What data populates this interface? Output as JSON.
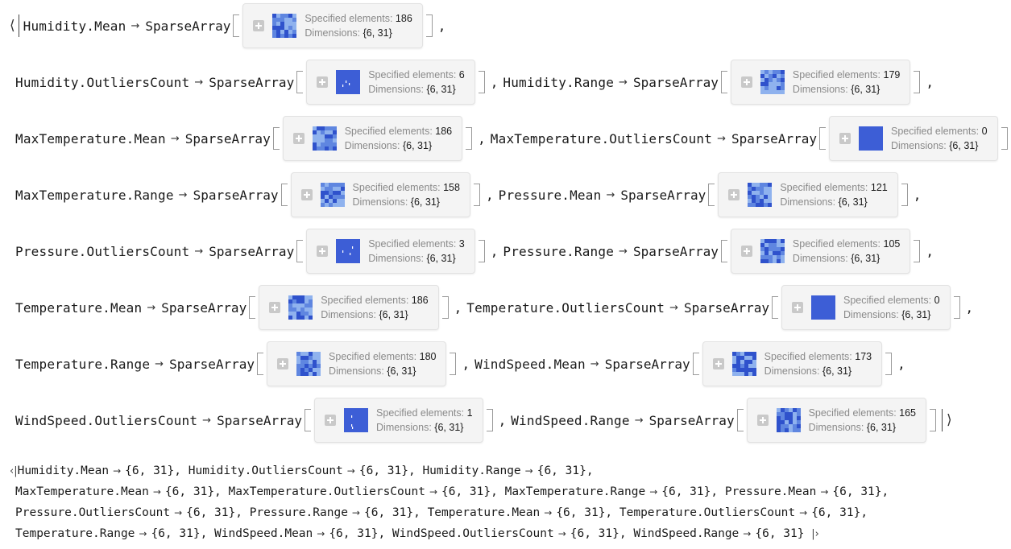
{
  "colors": {
    "blue": "#3d5ed6",
    "light_blue": "#7da3e8",
    "box_bg": "#f4f4f4",
    "label_gray": "#8a8a8a"
  },
  "labels": {
    "sparse_array": "SparseArray",
    "specified_elements": "Specified elements:",
    "dimensions": "Dimensions:",
    "arrow": "→",
    "open_assoc": "⟨",
    "close_assoc": "⟩",
    "comma": ","
  },
  "entries": [
    {
      "key": "Humidity.Mean",
      "specified": "186",
      "dims": "{6, 31}",
      "thumb": "dense"
    },
    {
      "key": "Humidity.OutliersCount",
      "specified": "6",
      "dims": "{6, 31}",
      "thumb": "sparse"
    },
    {
      "key": "Humidity.Range",
      "specified": "179",
      "dims": "{6, 31}",
      "thumb": "dense"
    },
    {
      "key": "MaxTemperature.Mean",
      "specified": "186",
      "dims": "{6, 31}",
      "thumb": "dense"
    },
    {
      "key": "MaxTemperature.OutliersCount",
      "specified": "0",
      "dims": "{6, 31}",
      "thumb": "empty"
    },
    {
      "key": "MaxTemperature.Range",
      "specified": "158",
      "dims": "{6, 31}",
      "thumb": "dense"
    },
    {
      "key": "Pressure.Mean",
      "specified": "121",
      "dims": "{6, 31}",
      "thumb": "dense"
    },
    {
      "key": "Pressure.OutliersCount",
      "specified": "3",
      "dims": "{6, 31}",
      "thumb": "sparse"
    },
    {
      "key": "Pressure.Range",
      "specified": "105",
      "dims": "{6, 31}",
      "thumb": "dense"
    },
    {
      "key": "Temperature.Mean",
      "specified": "186",
      "dims": "{6, 31}",
      "thumb": "dense"
    },
    {
      "key": "Temperature.OutliersCount",
      "specified": "0",
      "dims": "{6, 31}",
      "thumb": "empty"
    },
    {
      "key": "Temperature.Range",
      "specified": "180",
      "dims": "{6, 31}",
      "thumb": "dense"
    },
    {
      "key": "WindSpeed.Mean",
      "specified": "173",
      "dims": "{6, 31}",
      "thumb": "dense"
    },
    {
      "key": "WindSpeed.OutliersCount",
      "specified": "1",
      "dims": "{6, 31}",
      "thumb": "sparse"
    },
    {
      "key": "WindSpeed.Range",
      "specified": "165",
      "dims": "{6, 31}",
      "thumb": "dense"
    }
  ],
  "summary": {
    "open": "‹|",
    "close": "|›",
    "value": "{6, 31}",
    "keys": [
      "Humidity.Mean",
      "Humidity.OutliersCount",
      "Humidity.Range",
      "MaxTemperature.Mean",
      "MaxTemperature.OutliersCount",
      "MaxTemperature.Range",
      "Pressure.Mean",
      "Pressure.OutliersCount",
      "Pressure.Range",
      "Temperature.Mean",
      "Temperature.OutliersCount",
      "Temperature.Range",
      "WindSpeed.Mean",
      "WindSpeed.OutliersCount",
      "WindSpeed.Range"
    ]
  }
}
